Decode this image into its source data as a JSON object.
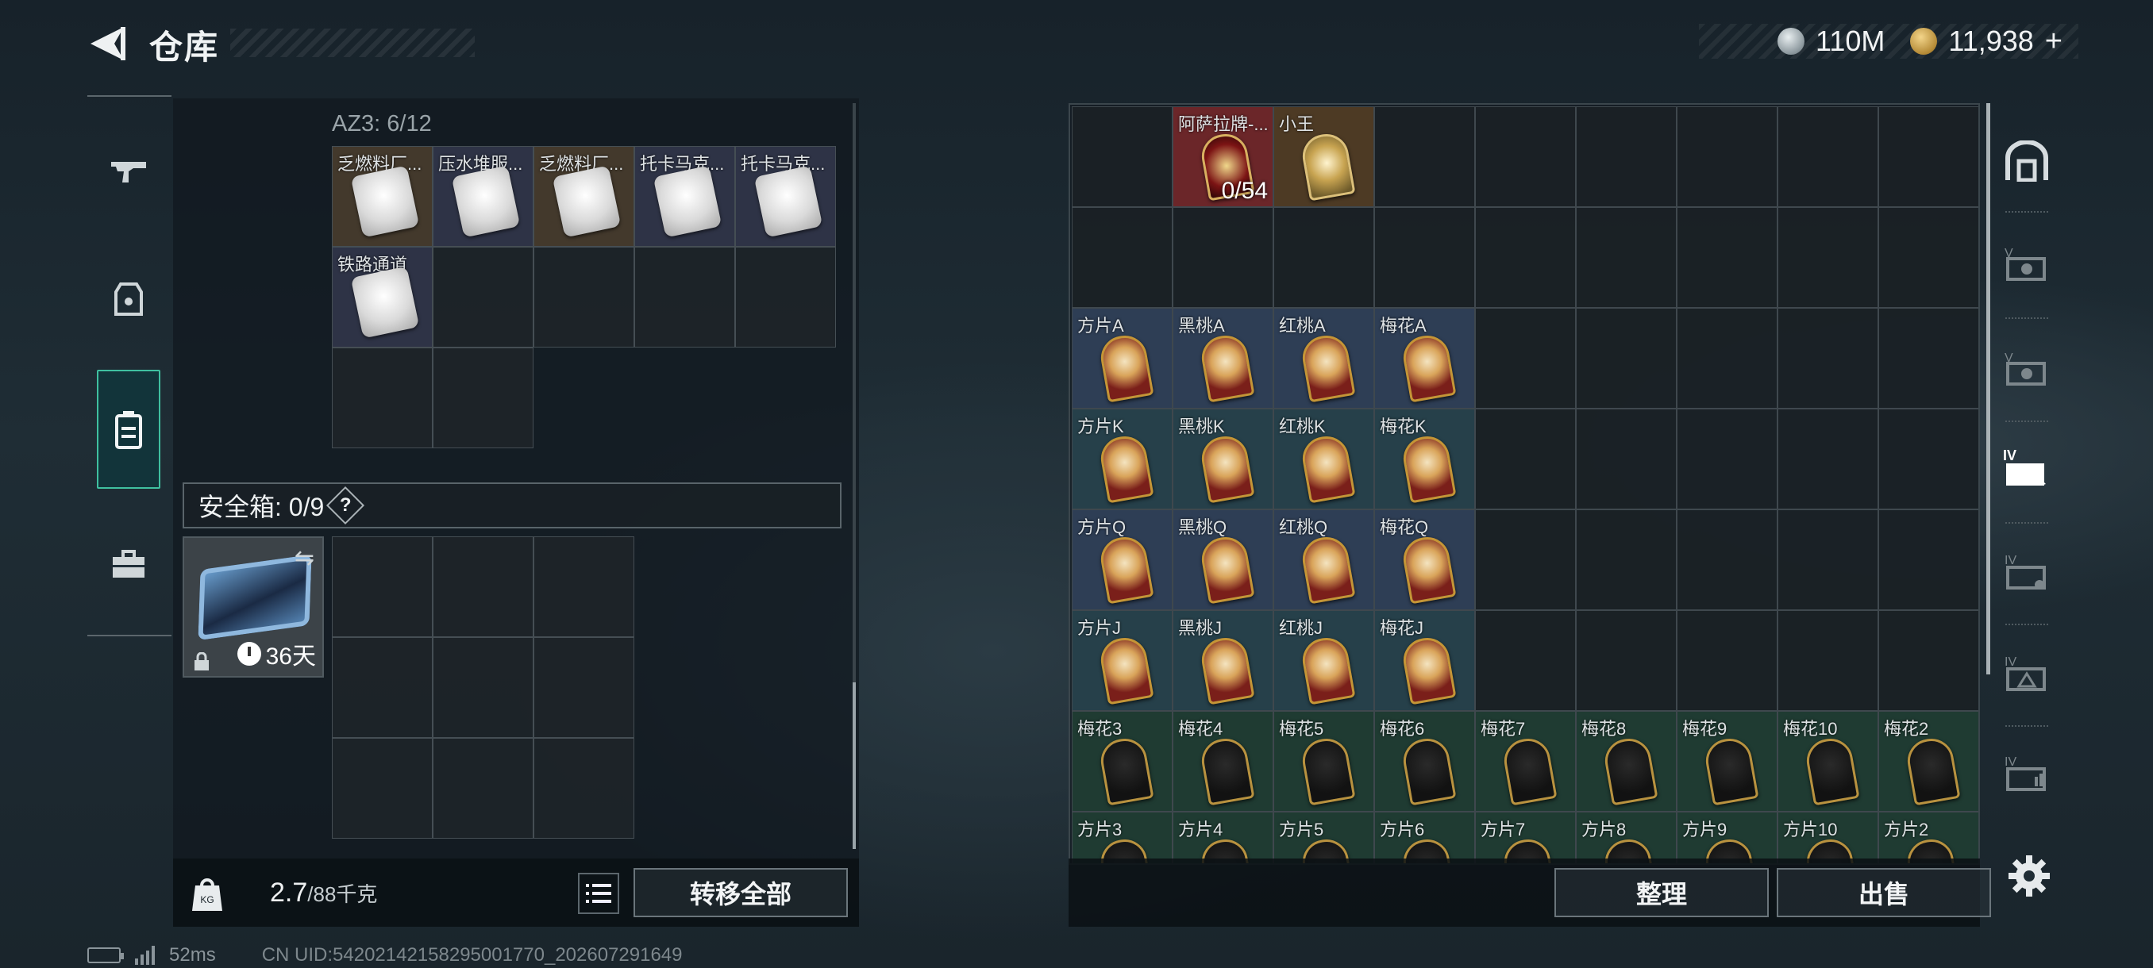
{
  "header": {
    "title": "仓库"
  },
  "currency": {
    "silver": "110M",
    "gold": "11,938",
    "gold_plus": "+"
  },
  "left_nav": {
    "items": [
      "weapon-icon",
      "armor-icon",
      "backpack-icon",
      "case-icon"
    ],
    "active": "backpack-icon"
  },
  "container": {
    "label": "AZ3: 6/12",
    "items": [
      "乏燃料厂...",
      "压水堆服...",
      "乏燃料厂...",
      "托卡马克...",
      "托卡马克...",
      "铁路通道"
    ]
  },
  "safebox": {
    "label": "安全箱: 0/9",
    "help": "?",
    "days": "36天"
  },
  "bottom_left": {
    "weight_value": "2.7",
    "weight_cap": "/88千克",
    "transfer_label": "转移全部"
  },
  "stash": {
    "special": [
      {
        "label": "阿萨拉牌-...",
        "count": "0/54"
      },
      {
        "label": "小王",
        "count": ""
      }
    ],
    "rows": [
      [
        "方片A",
        "黑桃A",
        "红桃A",
        "梅花A"
      ],
      [
        "方片K",
        "黑桃K",
        "红桃K",
        "梅花K"
      ],
      [
        "方片Q",
        "黑桃Q",
        "红桃Q",
        "梅花Q"
      ],
      [
        "方片J",
        "黑桃J",
        "红桃J",
        "梅花J"
      ],
      [
        "梅花3",
        "梅花4",
        "梅花5",
        "梅花6",
        "梅花7",
        "梅花8",
        "梅花9",
        "梅花10",
        "梅花2"
      ],
      [
        "方片3",
        "方片4",
        "方片5",
        "方片6",
        "方片7",
        "方片8",
        "方片9",
        "方片10",
        "方片2"
      ]
    ],
    "sort_label": "整理",
    "sell_label": "出售"
  },
  "right_nav": {
    "items": [
      "home-icon",
      "ticket-v-1-icon",
      "ticket-v-2-icon",
      "ticket-iv-1-icon",
      "ticket-iv-2-icon",
      "ticket-iv-3-icon",
      "ticket-iv-4-icon",
      "settings-icon"
    ],
    "active": "ticket-iv-1-icon"
  },
  "status": {
    "ping": "52ms",
    "uid": "CN UID:54202142158295001770_202607291649"
  },
  "colors": {
    "accent": "#3fc0a0",
    "red_cell": "#6b2629",
    "card_cell": "#2e3e55",
    "club_cell": "#1f3b32"
  }
}
